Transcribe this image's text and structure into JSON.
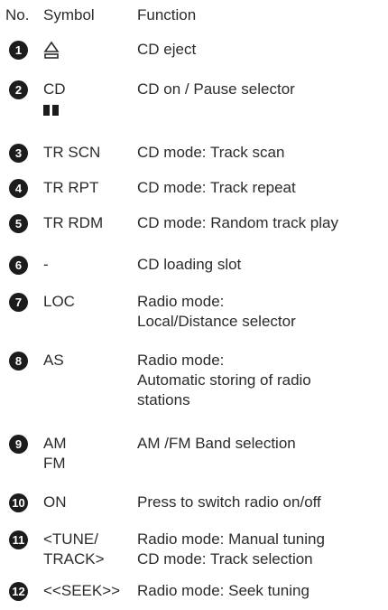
{
  "header": {
    "no": "No.",
    "symbol": "Symbol",
    "function": "Function"
  },
  "rows": [
    {
      "number": "1",
      "symbol_icon": "eject-icon",
      "function": [
        "CD eject"
      ]
    },
    {
      "number": "2",
      "symbol": [
        "CD"
      ],
      "symbol_icon": "pause-icon",
      "function": [
        "CD on / Pause selector"
      ]
    },
    {
      "number": "3",
      "symbol": [
        "TR SCN"
      ],
      "function": [
        "CD mode: Track scan"
      ]
    },
    {
      "number": "4",
      "symbol": [
        "TR RPT"
      ],
      "function": [
        "CD mode: Track repeat"
      ]
    },
    {
      "number": "5",
      "symbol": [
        "TR RDM"
      ],
      "function": [
        "CD mode: Random track play"
      ]
    },
    {
      "number": "6",
      "symbol": [
        "-"
      ],
      "function": [
        "CD loading slot"
      ]
    },
    {
      "number": "7",
      "symbol": [
        "LOC"
      ],
      "function": [
        "Radio mode:",
        "Local/Distance selector"
      ]
    },
    {
      "number": "8",
      "symbol": [
        "AS"
      ],
      "function": [
        "Radio mode:",
        "Automatic storing of radio",
        "stations"
      ]
    },
    {
      "number": "9",
      "symbol": [
        "AM",
        "FM"
      ],
      "function": [
        "AM /FM Band selection"
      ]
    },
    {
      "number": "10",
      "symbol": [
        "ON"
      ],
      "function": [
        "Press to switch radio on/off"
      ]
    },
    {
      "number": "11",
      "symbol": [
        "<TUNE/",
        "TRACK>"
      ],
      "function": [
        "Radio mode: Manual tuning",
        "CD mode: Track selection"
      ]
    },
    {
      "number": "12",
      "symbol": [
        "<<SEEK>>"
      ],
      "function": [
        "Radio mode: Seek tuning"
      ]
    }
  ]
}
